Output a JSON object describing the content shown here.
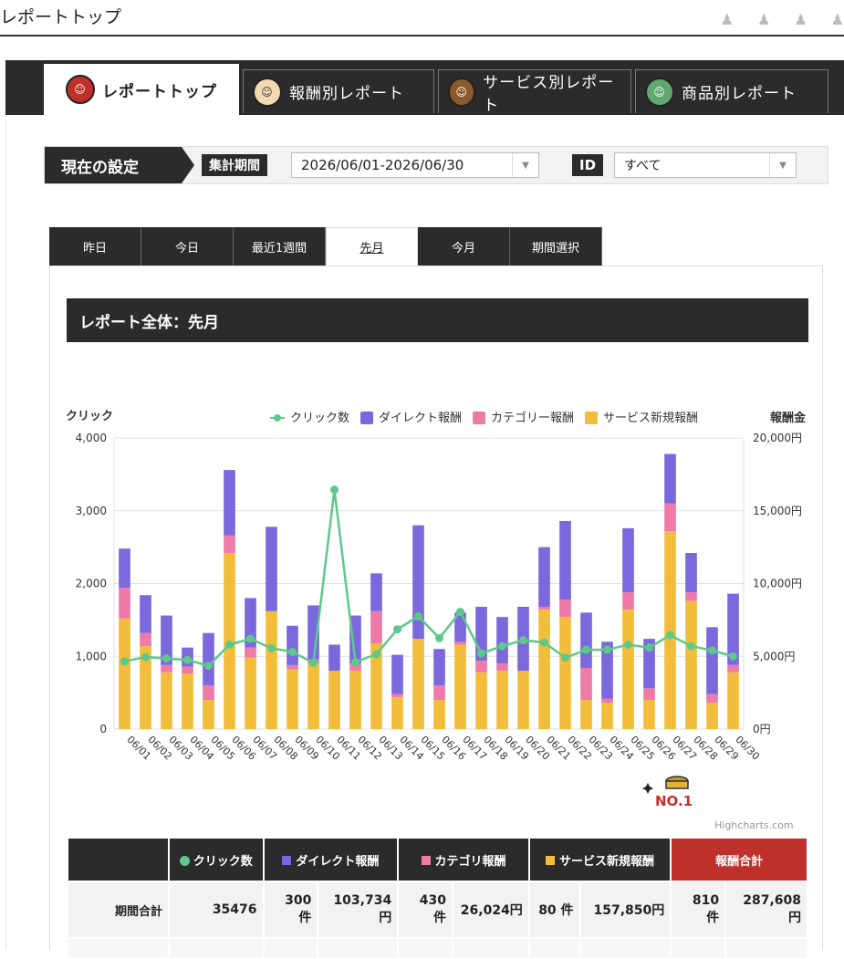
{
  "header": {
    "title": "レポートトップ"
  },
  "main_tabs": [
    {
      "label": "レポートトップ",
      "icon": "samurai-mascot-icon"
    },
    {
      "label": "報酬別レポート",
      "icon": "girl-mascot-icon"
    },
    {
      "label": "サービス別レポート",
      "icon": "bear-mascot-icon"
    },
    {
      "label": "商品別レポート",
      "icon": "frog-mascot-icon"
    }
  ],
  "settings": {
    "label": "現在の設定",
    "period_label": "集計期間",
    "period_value": "2026/06/01-2026/06/30",
    "id_label": "ID",
    "id_value": "すべて"
  },
  "period_tabs": [
    "昨日",
    "今日",
    "最近1週間",
    "先月",
    "今月",
    "期間選択"
  ],
  "active_period": 3,
  "section_title": "レポート全体：先月",
  "colors": {
    "click": "#5cc98a",
    "direct": "#7b68dd",
    "category": "#ee7aa8",
    "service": "#f2bd3a",
    "total_header": "#c0302a",
    "dark": "#2b2b2b"
  },
  "chart_data": {
    "type": "bar",
    "stacked": true,
    "left_axis_label": "クリック",
    "right_axis_label": "報酬金",
    "left_ylim": [
      0,
      4000
    ],
    "right_ylim": [
      0,
      20000
    ],
    "left_ticks": [
      "0",
      "1,000",
      "2,000",
      "3,000",
      "4,000"
    ],
    "right_ticks": [
      "0円",
      "5,000円",
      "10,000円",
      "15,000円",
      "20,000円"
    ],
    "legend_position": "top",
    "grid": true,
    "categories": [
      "06/01",
      "06/02",
      "06/03",
      "06/04",
      "06/05",
      "06/06",
      "06/07",
      "06/08",
      "06/09",
      "06/10",
      "06/11",
      "06/12",
      "06/13",
      "06/14",
      "06/15",
      "06/16",
      "06/17",
      "06/18",
      "06/19",
      "06/20",
      "06/21",
      "06/22",
      "06/23",
      "06/24",
      "06/25",
      "06/26",
      "06/27",
      "06/28",
      "06/29",
      "06/30"
    ],
    "series": [
      {
        "name": "サービス新規報酬",
        "axis": "right",
        "values": [
          7600,
          5700,
          3900,
          3800,
          2000,
          12100,
          4900,
          8100,
          4100,
          4500,
          4000,
          4000,
          5900,
          2200,
          6200,
          2000,
          5800,
          3900,
          4000,
          4000,
          8200,
          7700,
          2000,
          1800,
          8200,
          2000,
          13600,
          8800,
          1800,
          3900
        ]
      },
      {
        "name": "カテゴリー報酬",
        "axis": "right",
        "values": [
          2100,
          900,
          500,
          500,
          1000,
          1200,
          700,
          0,
          300,
          300,
          0,
          500,
          2200,
          200,
          0,
          1000,
          200,
          800,
          500,
          0,
          200,
          1200,
          2200,
          300,
          1200,
          800,
          1900,
          600,
          600,
          500
        ]
      },
      {
        "name": "ダイレクト報酬",
        "axis": "right",
        "values": [
          2700,
          2600,
          3400,
          1300,
          3600,
          4500,
          3400,
          5800,
          2700,
          3700,
          1800,
          3300,
          2600,
          2700,
          7800,
          2500,
          2000,
          3700,
          3200,
          4400,
          4100,
          5400,
          3800,
          3900,
          4400,
          3400,
          3400,
          2700,
          4600,
          4900
        ]
      },
      {
        "name": "クリック数",
        "axis": "left",
        "type": "line",
        "values": [
          930,
          990,
          970,
          950,
          870,
          1160,
          1240,
          1110,
          1060,
          910,
          3290,
          920,
          1030,
          1370,
          1550,
          1250,
          1610,
          1040,
          1140,
          1220,
          1190,
          980,
          1090,
          1090,
          1160,
          1120,
          1290,
          1140,
          1080,
          1000
        ]
      }
    ],
    "legend": [
      "クリック数",
      "ダイレクト報酬",
      "カテゴリー報酬",
      "サービス新規報酬"
    ],
    "credits": "Highcharts.com"
  },
  "badge": {
    "text": "NO.1"
  },
  "summary": {
    "headers": [
      "クリック数",
      "ダイレクト報酬",
      "カテゴリ報酬",
      "サービス新規報酬",
      "報酬合計"
    ],
    "row_label": "期間合計",
    "clicks": "35476",
    "direct_count": "300 件",
    "direct_amount": "103,734 円",
    "category_count": "430 件",
    "category_amount": "26,024円",
    "service_count": "80 件",
    "service_amount": "157,850円",
    "total_count": "810 件",
    "total_amount": "287,608 円"
  }
}
